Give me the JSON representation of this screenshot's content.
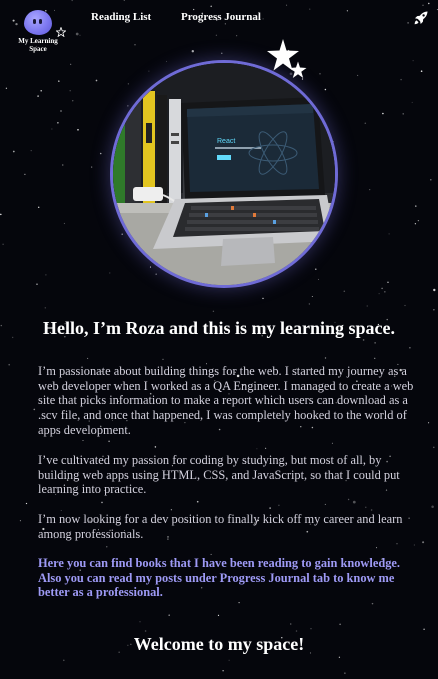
{
  "header": {
    "logo_text": "My Learning Space",
    "nav": [
      {
        "label": "Reading List"
      },
      {
        "label": "Progress Journal"
      }
    ],
    "action_icon": "rocket-icon"
  },
  "hero": {
    "image_description_icon": "laptop-photo",
    "screen_title": "React",
    "decor_icons": [
      "sparkle-star-icon",
      "sparkle-star-icon"
    ]
  },
  "main": {
    "greeting": "Hello, I’m Roza and this is my learning space.",
    "paragraphs": [
      "I’m passionate about building things for the web. I started my journey as a web developer when I worked as a QA Engineer. I managed to create a web site that picks information to make a report which users can download as a .scv file, and once that happened, I was completely hooked to the world of apps development.",
      "I’ve cultivated my passion for coding by studying, but most of all, by building web apps using HTML, CSS, and JavaScript, so that I could put learning into practice.",
      "I’m now looking for a dev position to finally kick off my career and learn among professionals."
    ],
    "highlight": "Here you can find books that I have been reading to gain knowledge. Also you can read my posts under Progress Journal tab to know me better as a professional.",
    "welcome": "Welcome to my space!"
  },
  "colors": {
    "background": "#05060c",
    "accent": "#7d78f0",
    "highlight_text": "#9e9af5",
    "body_text": "#d4d2de",
    "ring": "#6f6bd6"
  }
}
